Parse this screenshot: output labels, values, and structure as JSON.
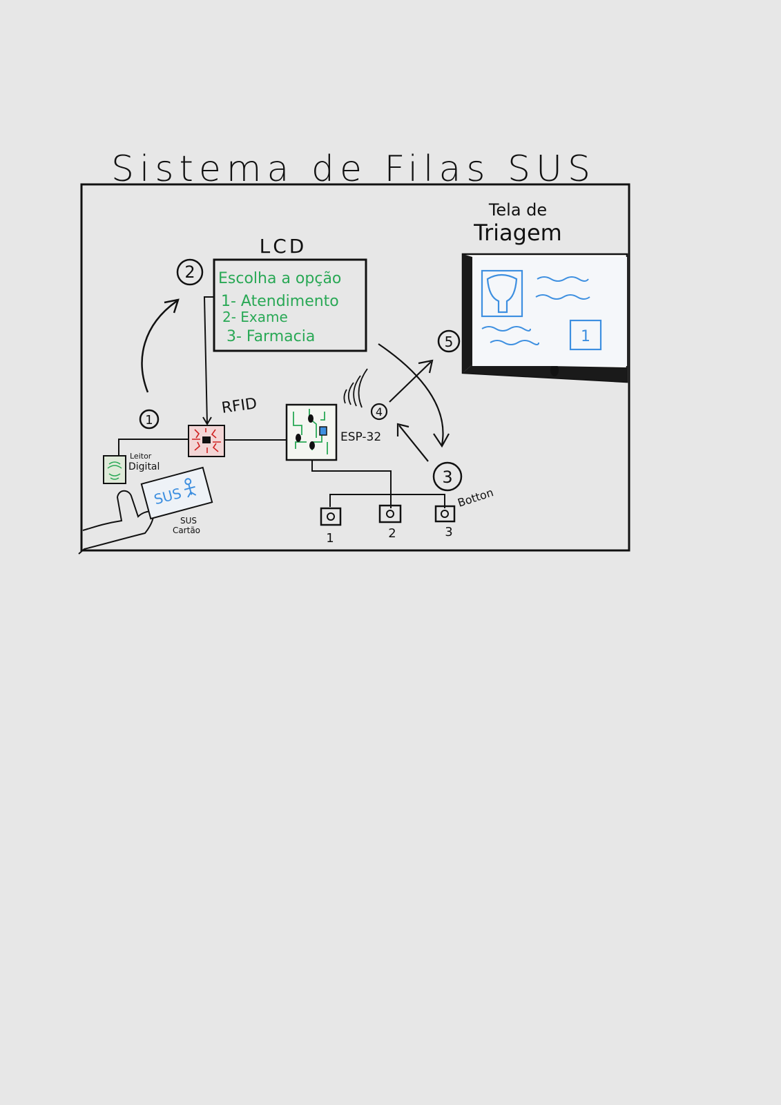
{
  "title": "Sistema de Filas SUS",
  "lcd": {
    "label": "LCD",
    "lines": [
      "Escolha a opção",
      "1- Atendimento",
      "2- Exame",
      "3- Farmacia"
    ]
  },
  "screen_label_line1": "Tela de",
  "screen_label_line2": "Triagem",
  "rfid_label": "RFID",
  "esp_label": "ESP-32",
  "reader_label_line1": "Leitor",
  "reader_label_line2": "Digital",
  "card_text": "SUS",
  "card_label_line1": "SUS",
  "card_label_line2": "Cartão",
  "button_label": "Botton",
  "buttons": [
    "1",
    "2",
    "3"
  ],
  "screen_number": "1",
  "steps": [
    "1",
    "2",
    "3",
    "4",
    "5"
  ],
  "colors": {
    "ink": "#111111",
    "lcd_text": "#29a855",
    "screen_accent": "#3d8fe0",
    "rfid_chip": "#d02020"
  }
}
